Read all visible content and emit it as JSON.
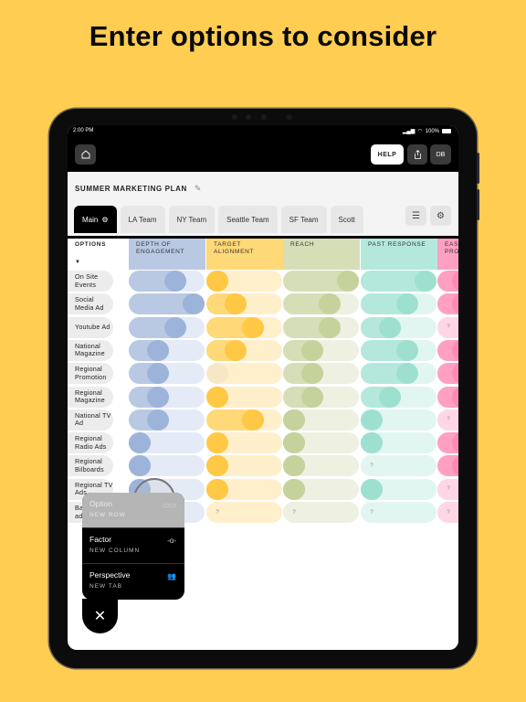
{
  "headline": "Enter options to consider",
  "status_bar": {
    "time": "2:00 PM",
    "signal": "signal-icon",
    "wifi": "wifi-icon",
    "battery": "100%"
  },
  "toolbar": {
    "home_icon": "home-icon",
    "help_label": "HELP",
    "share_icon": "share-icon",
    "user_initials": "DB"
  },
  "plan": {
    "title": "SUMMER MARKETING PLAN",
    "edit_icon": "pencil-icon"
  },
  "tabs": [
    {
      "label": "Main",
      "active": true,
      "icon": "gear-icon"
    },
    {
      "label": "LA Team"
    },
    {
      "label": "NY Team"
    },
    {
      "label": "Seattle Team"
    },
    {
      "label": "SF Team"
    },
    {
      "label": "Scott"
    }
  ],
  "tab_tools": {
    "filter_icon": "sliders-icon",
    "settings_icon": "gear-icon"
  },
  "table": {
    "options_header": "OPTIONS",
    "sort_icon": "caret-down-icon",
    "factors": [
      {
        "label": "DEPTH OF ENGAGEMENT",
        "line1": "DEPTH OF",
        "line2": "ENGAGEMENT",
        "color": "#b9c9e4",
        "light": "#e4eaf6",
        "dark": "#9db4da"
      },
      {
        "label": "TARGET ALIGNMENT",
        "line1": "TARGET",
        "line2": "ALIGNMENT",
        "color": "#ffd877",
        "light": "#ffefcb",
        "dark": "#ffc845"
      },
      {
        "label": "REACH",
        "line1": "REACH",
        "line2": "",
        "color": "#d6deb7",
        "light": "#eef0e2",
        "dark": "#c5d29c"
      },
      {
        "label": "PAST RESPONSE",
        "line1": "PAST RESPONSE",
        "line2": "",
        "color": "#b4e8dc",
        "light": "#e2f6f1",
        "dark": "#9ee0d0"
      },
      {
        "label": "EASE OF PRO...",
        "line1": "EAS",
        "line2": "PRO",
        "color": "#ff9fc2",
        "light": "#ffd6e6",
        "dark": "#ff8ab4"
      }
    ],
    "scale_max": 3,
    "rows": [
      {
        "line1": "On Site",
        "line2": "Events",
        "values": [
          2,
          0,
          3,
          3,
          3
        ]
      },
      {
        "line1": "Social",
        "line2": "Media Ad",
        "values": [
          3,
          1,
          2,
          2,
          3
        ]
      },
      {
        "line1": "Youtube Ad",
        "line2": "",
        "values": [
          2,
          2,
          2,
          1,
          null
        ]
      },
      {
        "line1": "National",
        "line2": "Magazine",
        "values": [
          1,
          1,
          1,
          2,
          3
        ]
      },
      {
        "line1": "Regional",
        "line2": "Promotion",
        "values": [
          1,
          "faint",
          1,
          2,
          3
        ]
      },
      {
        "line1": "Regional",
        "line2": "Magazine",
        "values": [
          1,
          0,
          1,
          1,
          3
        ]
      },
      {
        "line1": "National TV",
        "line2": "Ad",
        "values": [
          1,
          2,
          0,
          0,
          null
        ]
      },
      {
        "line1": "Regional",
        "line2": "Radio Ads",
        "values": [
          0,
          0,
          0,
          0,
          3
        ]
      },
      {
        "line1": "Regional",
        "line2": "Bilboards",
        "values": [
          0,
          0,
          0,
          null,
          3
        ]
      },
      {
        "line1": "Regional TV",
        "line2": "Ads",
        "values": [
          0,
          0,
          0,
          0,
          null
        ]
      },
      {
        "line1": "Ba",
        "line2": "ad",
        "values": [
          null,
          null,
          null,
          null,
          null
        ]
      }
    ],
    "unknown_marker": "?"
  },
  "add_menu": {
    "items": [
      {
        "title": "Option",
        "subtitle": "NEW ROW",
        "icon": "row-icon",
        "highlighted": true
      },
      {
        "title": "Factor",
        "subtitle": "NEW COLUMN",
        "icon": "column-slider-icon"
      },
      {
        "title": "Perspective",
        "subtitle": "NEW TAB",
        "icon": "people-icon"
      }
    ],
    "close_icon": "close-icon"
  }
}
